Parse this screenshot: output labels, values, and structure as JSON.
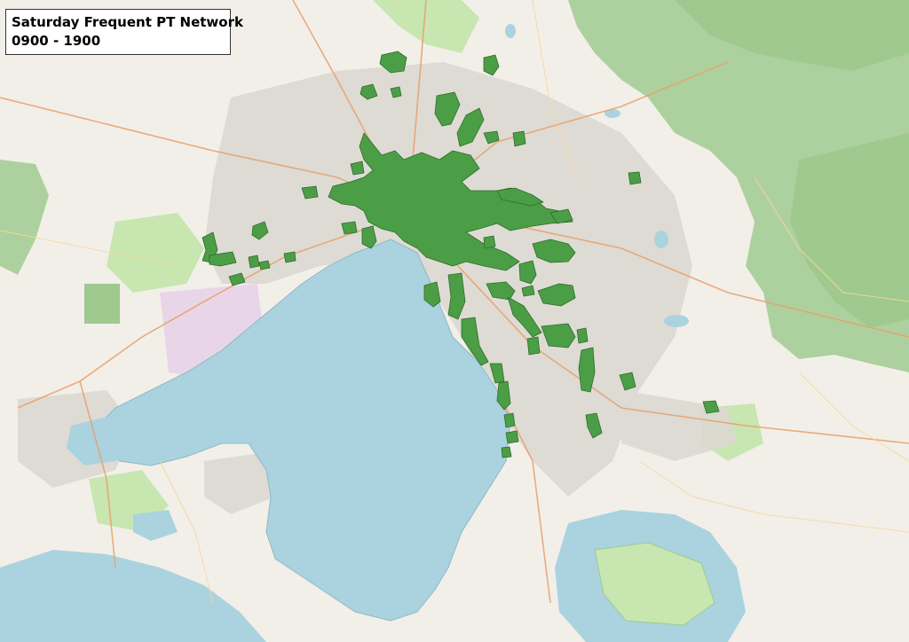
{
  "map": {
    "title": "Saturday Frequent PT Network",
    "subtitle": "0900 - 1900",
    "colors": {
      "land": "#f2efe9",
      "water": "#aad3df",
      "forest": "#add19e",
      "park": "#c8e6b0",
      "urban": "#dcd8d2",
      "industrial": "#e8d6e8",
      "network_fill": "#4c9e46",
      "network_stroke": "#2e6b2a",
      "road_major": "#e8a06a",
      "road_minor": "#f7d79a"
    }
  }
}
